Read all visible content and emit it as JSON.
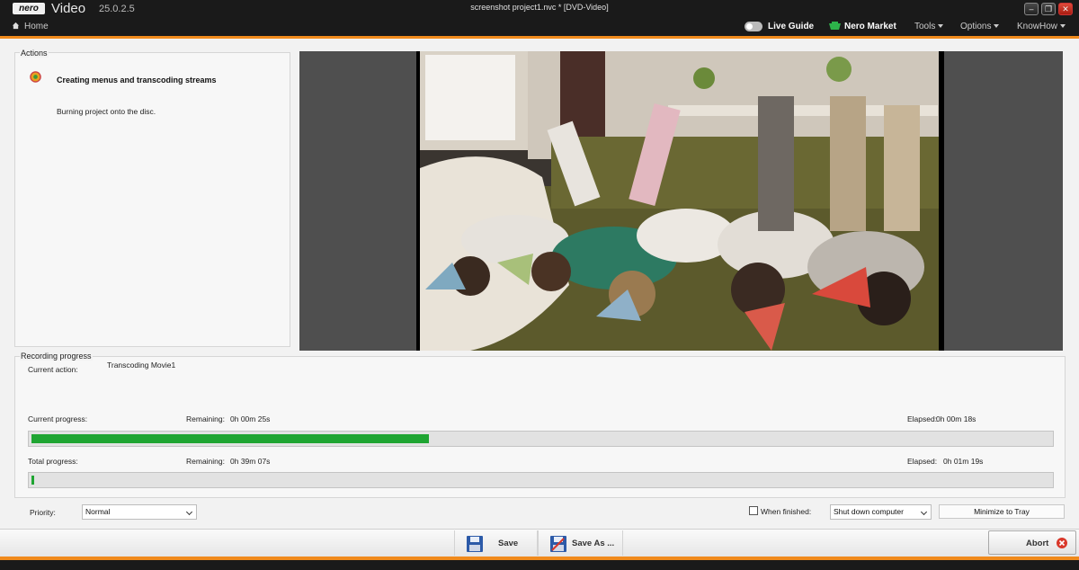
{
  "window": {
    "logo": "nero",
    "app_name": "Video",
    "version": "25.0.2.5",
    "document_title": "screenshot project1.nvc * [DVD-Video]",
    "controls": [
      "minimize-icon",
      "restore-icon",
      "close-icon"
    ]
  },
  "menubar": {
    "home": "Home",
    "live_guide": "Live Guide",
    "nero_market": "Nero Market",
    "items": [
      "Tools",
      "Options",
      "KnowHow"
    ]
  },
  "actions": {
    "section_label": "Actions",
    "title": "Creating menus and transcoding streams",
    "description": "Burning project onto the disc."
  },
  "recording": {
    "section_label": "Recording progress",
    "current_action_label": "Current action:",
    "current_action_value": "Transcoding Movie1",
    "current_progress_label": "Current progress:",
    "current_remaining_label": "Remaining:",
    "current_remaining_value": "0h 00m 25s",
    "current_elapsed_label": "Elapsed:",
    "current_elapsed_value": "0h 00m 18s",
    "current_progress_fraction": 0.39,
    "total_progress_label": "Total progress:",
    "total_remaining_label": "Remaining:",
    "total_remaining_value": "0h 39m 07s",
    "total_elapsed_label": "Elapsed:",
    "total_elapsed_value": "0h 01m 19s",
    "total_progress_fraction": 0.003
  },
  "options": {
    "priority_label": "Priority:",
    "priority_value": "Normal",
    "when_finished_label": "When finished:",
    "when_finished_checked": false,
    "when_finished_value": "Shut down computer",
    "minimize_to_tray": "Minimize to Tray"
  },
  "toolbar": {
    "save": "Save",
    "save_as": "Save As ...",
    "abort": "Abort"
  },
  "colors": {
    "accent": "#f08a1c",
    "progress": "#1fa532",
    "titlebar": "#1a1a1a",
    "abort_icon": "#d9382a"
  }
}
